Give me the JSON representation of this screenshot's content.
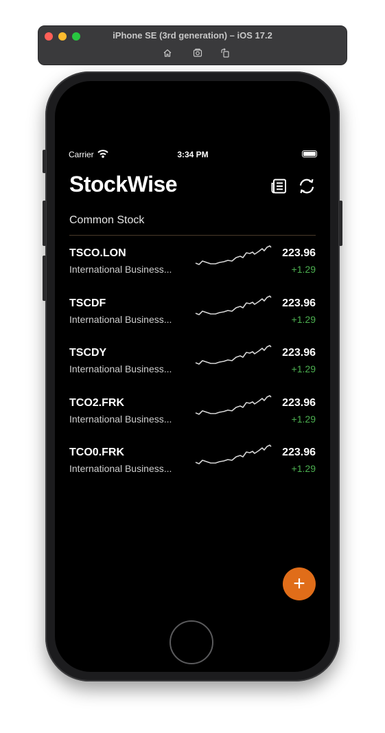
{
  "simulator": {
    "title": "iPhone SE (3rd generation) – iOS 17.2",
    "tools": [
      "home-icon",
      "screenshot-icon",
      "rotate-icon"
    ]
  },
  "status_bar": {
    "carrier": "Carrier",
    "time": "3:34 PM"
  },
  "app": {
    "title": "StockWise",
    "section_label": "Common Stock"
  },
  "colors": {
    "accent": "#e06d19",
    "positive": "#4caf50",
    "background": "#000000"
  },
  "stocks": [
    {
      "symbol": "TSCO.LON",
      "name": "International Business...",
      "price": "223.96",
      "change": "+1.29"
    },
    {
      "symbol": "TSCDF",
      "name": "International Business...",
      "price": "223.96",
      "change": "+1.29"
    },
    {
      "symbol": "TSCDY",
      "name": "International Business...",
      "price": "223.96",
      "change": "+1.29"
    },
    {
      "symbol": "TCO2.FRK",
      "name": "International Business...",
      "price": "223.96",
      "change": "+1.29"
    },
    {
      "symbol": "TCO0.FRK",
      "name": "International Business...",
      "price": "223.96",
      "change": "+1.29"
    }
  ],
  "fab": {
    "label": "+"
  }
}
